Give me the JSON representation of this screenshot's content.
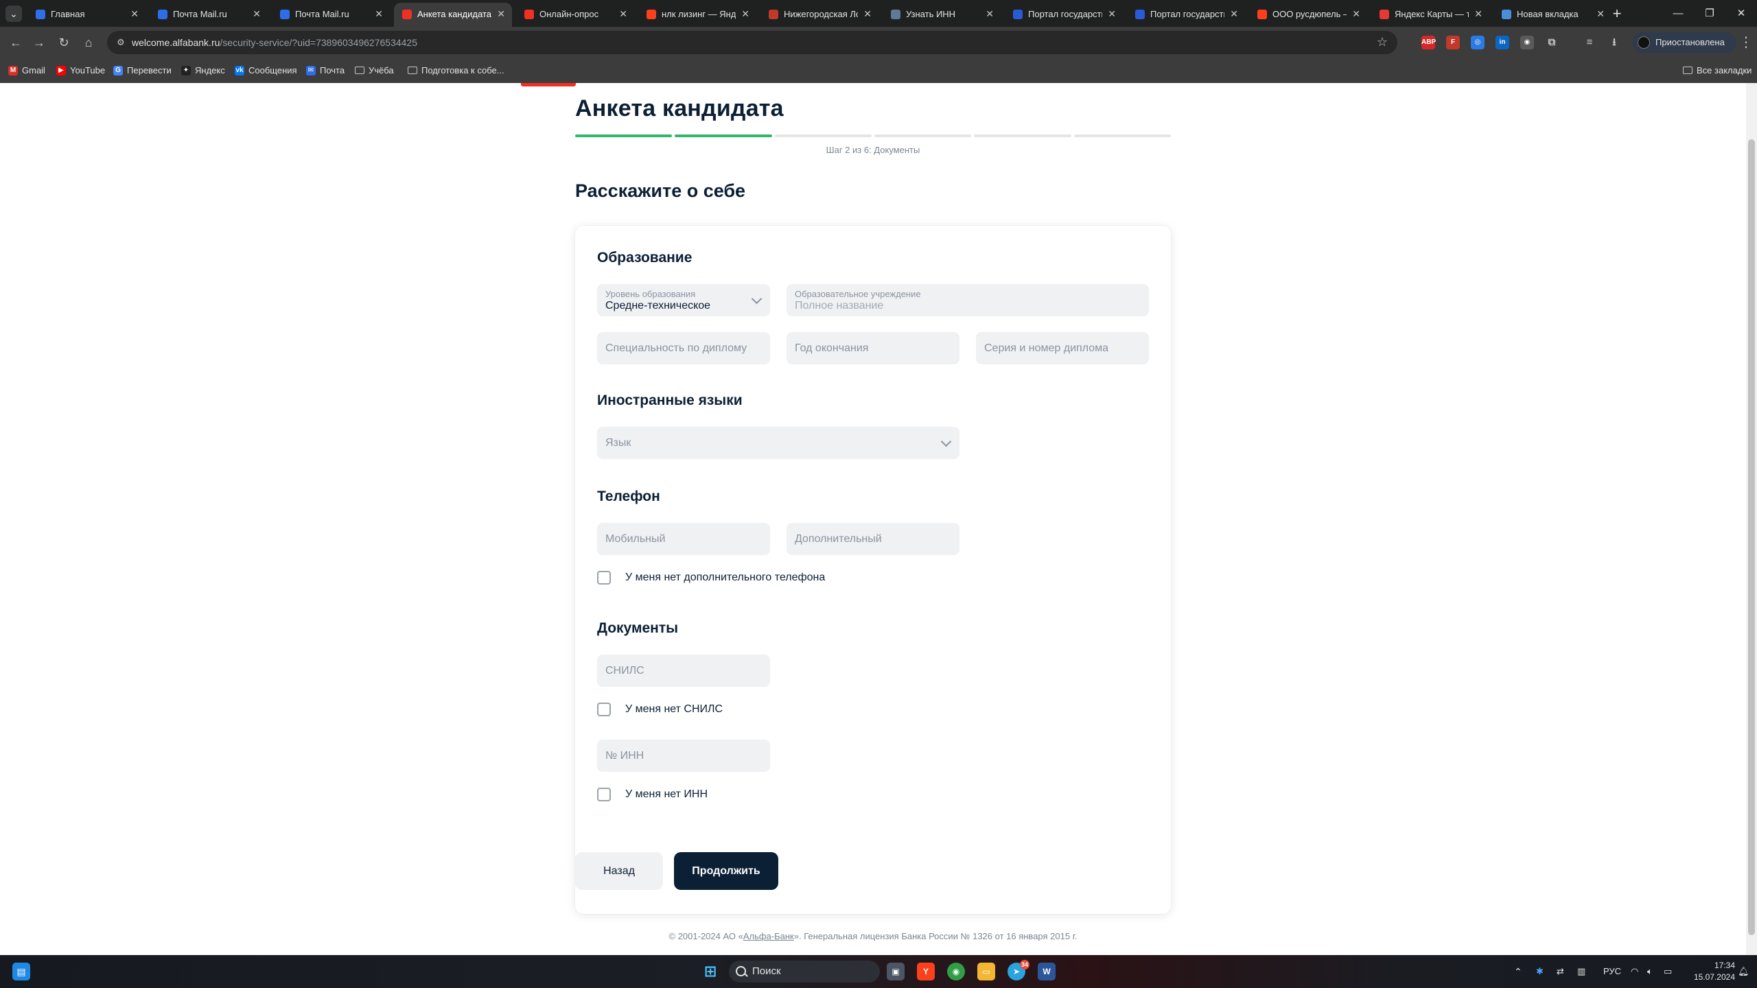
{
  "browser": {
    "tabs": [
      {
        "title": "Главная",
        "icon": "taskbar-app-icon",
        "color": "#2f6fe8",
        "active": false
      },
      {
        "title": "Почта Mail.ru",
        "icon": "mail-icon",
        "color": "#2d6ee8",
        "active": false
      },
      {
        "title": "Почта Mail.ru",
        "icon": "mail-icon",
        "color": "#2d6ee8",
        "active": false
      },
      {
        "title": "Анкета кандидата",
        "icon": "alfa-bank-icon",
        "color": "#ef3124",
        "active": true
      },
      {
        "title": "Онлайн-опрос",
        "icon": "alfa-bank-icon",
        "color": "#ef3124",
        "active": false
      },
      {
        "title": "нлк лизинг — Янде",
        "icon": "yandex-icon",
        "color": "#fc3f1d",
        "active": false
      },
      {
        "title": "Нижегородская Ло",
        "icon": "emblem-icon",
        "color": "#c0392b",
        "active": false
      },
      {
        "title": "Узнать ИНН",
        "icon": "globe-icon",
        "color": "#5f7a99",
        "active": false
      },
      {
        "title": "Портал государств",
        "icon": "flag-icon",
        "color": "#2a5bd7",
        "active": false
      },
      {
        "title": "Портал государств",
        "icon": "flag-icon",
        "color": "#2a5bd7",
        "active": false
      },
      {
        "title": "ООО русдюпель –",
        "icon": "yandex-icon",
        "color": "#fc3f1d",
        "active": false
      },
      {
        "title": "Яндекс Карты — тр",
        "icon": "map-pin-icon",
        "color": "#e53935",
        "active": false
      },
      {
        "title": "Новая вкладка",
        "icon": "new-tab-icon",
        "color": "#4a90d9",
        "active": false
      }
    ],
    "url_host": "welcome.alfabank.ru",
    "url_path": "/security-service/?uid=7389603496276534425",
    "profile_label": "Приостановлена",
    "bookmarks": [
      {
        "label": "Gmail",
        "icon": "gmail-icon",
        "color": "#d93025",
        "glyph": "M"
      },
      {
        "label": "YouTube",
        "icon": "youtube-icon",
        "color": "#ff0000",
        "glyph": "▶"
      },
      {
        "label": "Перевести",
        "icon": "translate-icon",
        "color": "#4285f4",
        "glyph": "G"
      },
      {
        "label": "Яндекс",
        "icon": "yandex-icon",
        "color": "#222222",
        "glyph": "✦"
      },
      {
        "label": "Сообщения",
        "icon": "vk-icon",
        "color": "#0077ff",
        "glyph": "vk"
      },
      {
        "label": "Почта",
        "icon": "mail-icon",
        "color": "#2d6ee8",
        "glyph": "✉"
      },
      {
        "label": "Учёба",
        "icon": "folder-icon",
        "color": "",
        "glyph": ""
      },
      {
        "label": "Подготовка к собе...",
        "icon": "folder-icon",
        "color": "",
        "glyph": ""
      }
    ],
    "all_bookmarks_label": "Все закладки"
  },
  "page": {
    "title": "Анкета кандидата",
    "progress": {
      "current": 2,
      "total": 6
    },
    "step_label": "Шаг 2 из 6: Документы",
    "section_heading": "Расскажите о себе",
    "education": {
      "title": "Образование",
      "level_label": "Уровень образования",
      "level_value": "Средне-техническое",
      "institution_label": "Образовательное учреждение",
      "institution_placeholder": "Полное название",
      "specialty_placeholder": "Специальность по диплому",
      "graduation_year_placeholder": "Год окончания",
      "diploma_placeholder": "Серия и номер диплома"
    },
    "languages": {
      "title": "Иностранные языки",
      "language_placeholder": "Язык"
    },
    "phone": {
      "title": "Телефон",
      "mobile_placeholder": "Мобильный",
      "extra_placeholder": "Дополнительный",
      "no_extra_label": "У меня нет дополнительного телефона"
    },
    "documents": {
      "title": "Документы",
      "snils_placeholder": "СНИЛС",
      "no_snils_label": "У меня нет СНИЛС",
      "inn_placeholder": "№ ИНН",
      "no_inn_label": "У меня нет ИНН"
    },
    "back_label": "Назад",
    "continue_label": "Продолжить",
    "footer_prefix": "© 2001-2024 АО «",
    "footer_link": "Альфа-Банк",
    "footer_suffix": "». Генеральная лицензия Банка России № 1326 от 16 января 2015 г."
  },
  "taskbar": {
    "search_label": "Поиск",
    "language": "РУС",
    "time": "17:34",
    "date": "15.07.2024",
    "telegram_badge": "34"
  },
  "colors": {
    "accent_red": "#ef3124",
    "progress_done": "#2eb86e",
    "primary_button": "#0b1f35"
  }
}
